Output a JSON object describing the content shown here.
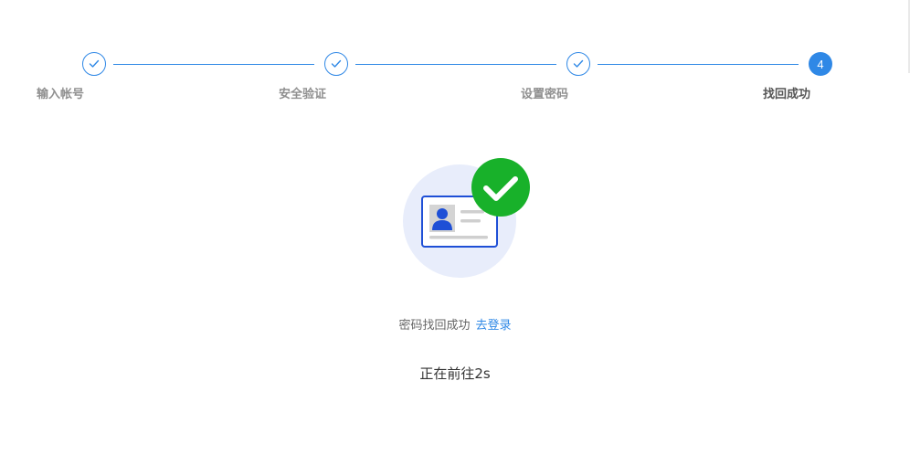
{
  "steps": [
    {
      "label": "输入帐号",
      "status": "done"
    },
    {
      "label": "安全验证",
      "status": "done"
    },
    {
      "label": "设置密码",
      "status": "done"
    },
    {
      "label": "找回成功",
      "status": "current",
      "number": "4"
    }
  ],
  "result": {
    "message": "密码找回成功",
    "login_link": "去登录",
    "countdown": "正在前往2s"
  },
  "illustration": {
    "icon": "id-card-success-icon",
    "badge_icon": "check-circle-icon"
  },
  "colors": {
    "accent": "#2f88e6",
    "success": "#18b12a",
    "card_border": "#1e4fd6",
    "halo": "#e8edfb"
  }
}
